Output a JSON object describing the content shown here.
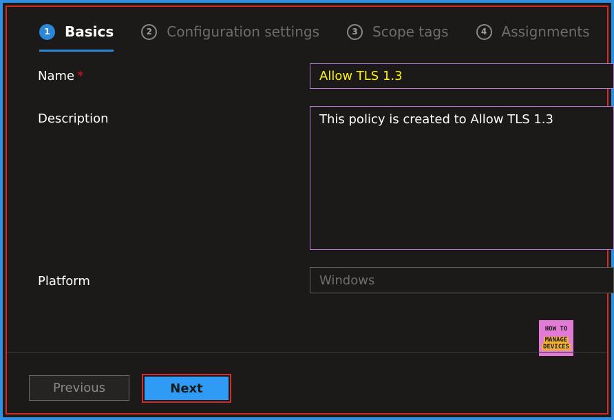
{
  "wizard": {
    "steps": [
      {
        "number": "1",
        "label": "Basics",
        "active": true
      },
      {
        "number": "2",
        "label": "Configuration settings",
        "active": false
      },
      {
        "number": "3",
        "label": "Scope tags",
        "active": false
      },
      {
        "number": "4",
        "label": "Assignments",
        "active": false
      }
    ]
  },
  "form": {
    "name_label": "Name",
    "required_marker": "*",
    "name_value": "Allow TLS 1.3",
    "description_label": "Description",
    "description_value": "This policy is created to Allow TLS 1.3",
    "platform_label": "Platform",
    "platform_value": "Windows"
  },
  "logo": {
    "line1": "HOW TO",
    "line2": "MANAGE",
    "line3": "DEVICES"
  },
  "footer": {
    "previous_label": "Previous",
    "next_label": "Next"
  },
  "colors": {
    "accent": "#2b88d8",
    "next_button": "#2f9bf5",
    "highlight_border": "#d42a2a",
    "field_border": "#b87ae0",
    "name_text": "#fff200"
  }
}
